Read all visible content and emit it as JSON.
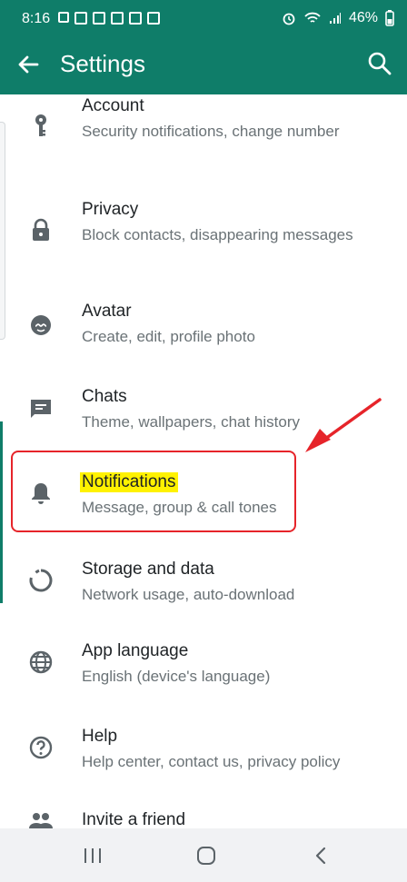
{
  "status_bar": {
    "time": "8:16",
    "battery": "46%"
  },
  "app_bar": {
    "title": "Settings"
  },
  "settings": [
    {
      "icon": "key-icon",
      "title": "Account",
      "subtitle": "Security notifications, change number"
    },
    {
      "icon": "lock-icon",
      "title": "Privacy",
      "subtitle": "Block contacts, disappearing messages"
    },
    {
      "icon": "avatar-icon",
      "title": "Avatar",
      "subtitle": "Create, edit, profile photo"
    },
    {
      "icon": "chat-icon",
      "title": "Chats",
      "subtitle": "Theme, wallpapers, chat history"
    },
    {
      "icon": "bell-icon",
      "title": "Notifications",
      "subtitle": "Message, group & call tones"
    },
    {
      "icon": "storage-icon",
      "title": "Storage and data",
      "subtitle": "Network usage, auto-download"
    },
    {
      "icon": "globe-icon",
      "title": "App language",
      "subtitle": "English (device's language)"
    },
    {
      "icon": "help-icon",
      "title": "Help",
      "subtitle": "Help center, contact us, privacy policy"
    },
    {
      "icon": "people-icon",
      "title": "Invite a friend",
      "subtitle": ""
    }
  ],
  "colors": {
    "header": "#0f7d69",
    "highlight": "#fff200",
    "callout": "#e6242a"
  }
}
